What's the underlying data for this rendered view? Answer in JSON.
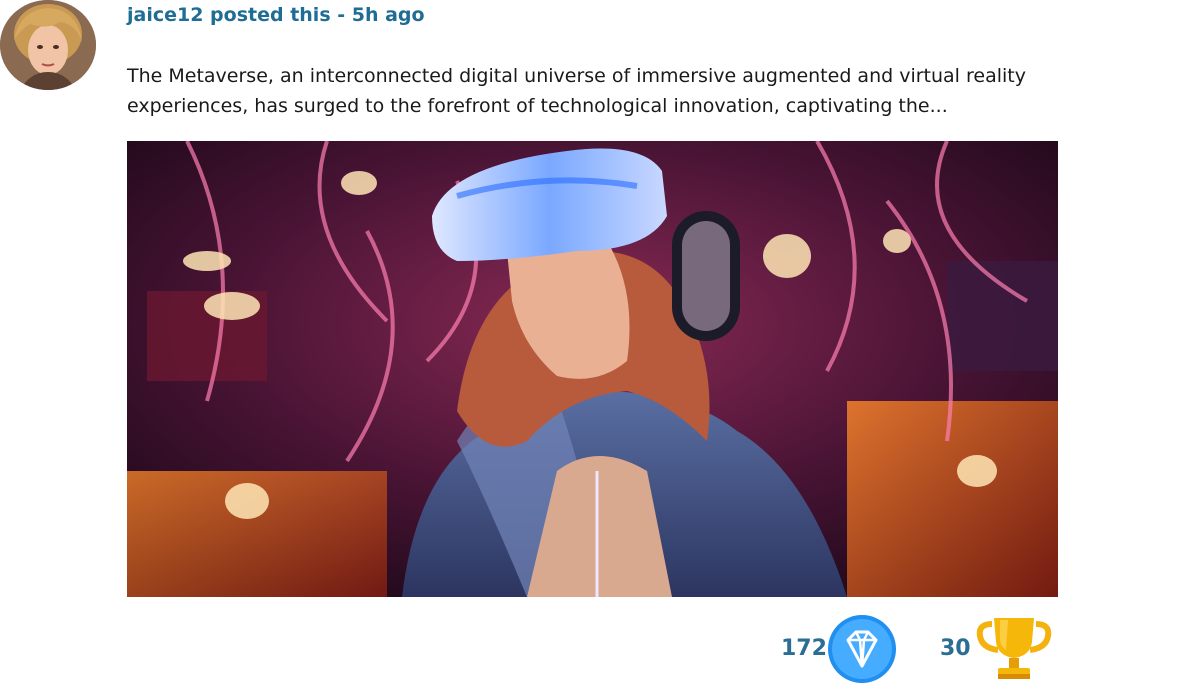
{
  "post": {
    "header": "jaice12 posted this - 5h ago",
    "body": "The Metaverse, an interconnected digital universe of immersive augmented and virtual reality experiences, has surged to the forefront of technological innovation, captivating the..."
  },
  "stats": {
    "gems": "172",
    "trophies": "30"
  },
  "icons": {
    "gem": "diamond-icon",
    "trophy": "trophy-icon"
  },
  "colors": {
    "header": "#1f6d94",
    "count": "#2b6d94",
    "gem_blue": "#2196f3",
    "trophy_gold": "#f5b70a"
  }
}
